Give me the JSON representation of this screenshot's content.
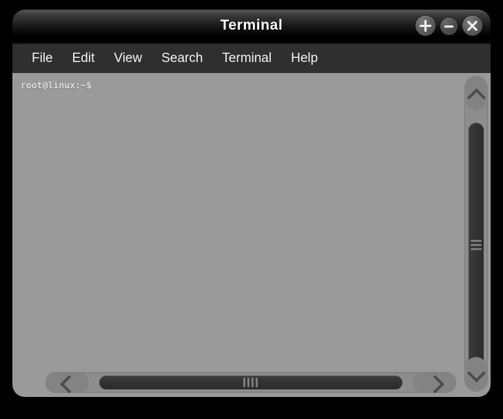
{
  "window": {
    "title": "Terminal",
    "controls": [
      {
        "name": "maximize-button",
        "icon": "plus-icon",
        "label": "+"
      },
      {
        "name": "minimize-button",
        "icon": "minus-icon",
        "label": "−"
      },
      {
        "name": "close-button",
        "icon": "close-icon",
        "label": "×"
      }
    ]
  },
  "menubar": {
    "items": [
      {
        "label": "File"
      },
      {
        "label": "Edit"
      },
      {
        "label": "View"
      },
      {
        "label": "Search"
      },
      {
        "label": "Terminal"
      },
      {
        "label": "Help"
      }
    ]
  },
  "terminal": {
    "lines": [
      "root@linux:~$"
    ],
    "background_color": "#9a9a9a",
    "text_color": "#ffffff"
  },
  "scrollbars": {
    "vertical": {
      "up_arrow_icon": "chevron-up-icon",
      "down_arrow_icon": "chevron-down-icon",
      "grip_lines": 3
    },
    "horizontal": {
      "left_arrow_icon": "chevron-left-icon",
      "right_arrow_icon": "chevron-right-icon",
      "grip_lines": 4
    }
  }
}
